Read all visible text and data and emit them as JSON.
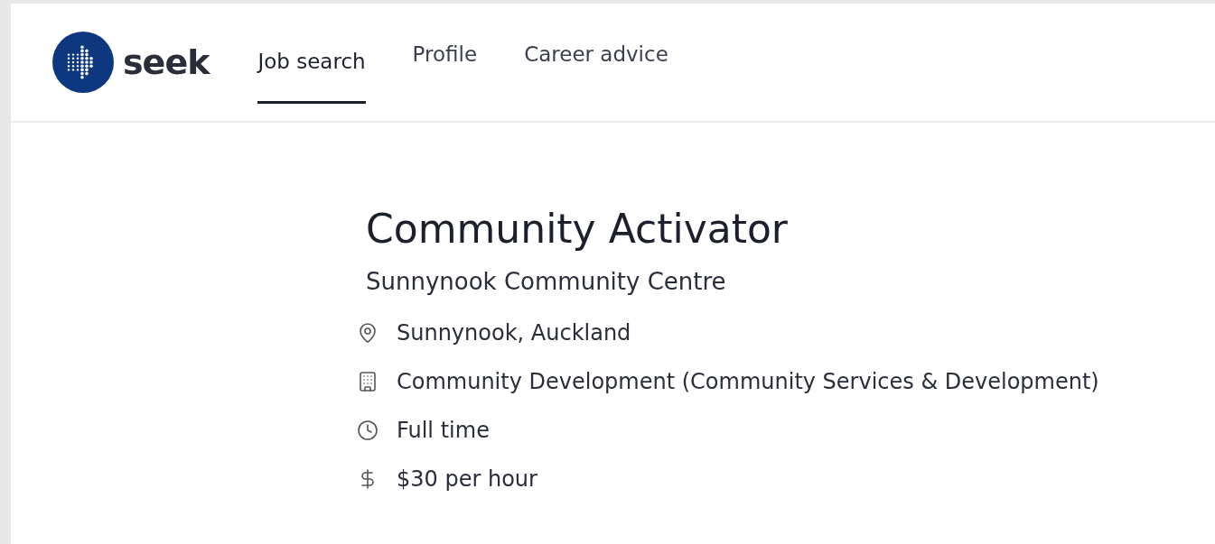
{
  "header": {
    "logo_text": "seek",
    "nav": [
      {
        "label": "Job search",
        "selected": true
      },
      {
        "label": "Profile",
        "selected": false
      },
      {
        "label": "Career advice",
        "selected": false
      }
    ]
  },
  "job": {
    "title": "Community Activator",
    "company": "Sunnynook Community Centre",
    "details": [
      {
        "kind": "location",
        "text": "Sunnynook, Auckland"
      },
      {
        "kind": "industry",
        "text": "Community Development (Community Services & Development)"
      },
      {
        "kind": "worktype",
        "text": "Full time"
      },
      {
        "kind": "salary",
        "text": "$30 per hour"
      }
    ]
  }
}
